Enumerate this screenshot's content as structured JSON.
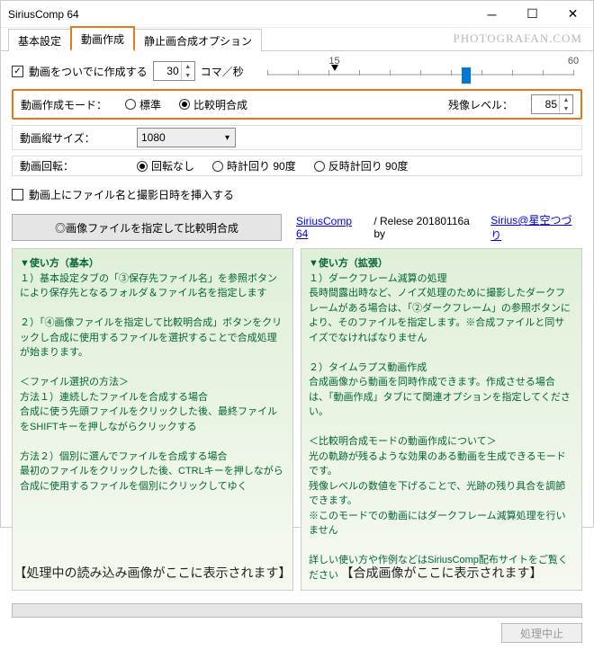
{
  "window": {
    "title": "SiriusComp 64"
  },
  "watermark": "PHOTOGRAFAN.COM",
  "tabs": [
    "基本設定",
    "動画作成",
    "静止画合成オプション"
  ],
  "active_tab": 1,
  "make_video": {
    "checked": true,
    "label": "動画をついでに作成する",
    "fps": "30",
    "fps_unit": "コマ／秒"
  },
  "slider": {
    "ticks": [
      "15",
      "60"
    ],
    "marker_pct": 22,
    "thumb_pct": 65
  },
  "mode_row": {
    "label": "動画作成モード：",
    "opt_std": "標準",
    "opt_comp": "比較明合成",
    "selected": "comp",
    "afterimg_label": "残像レベル：",
    "afterimg_val": "85"
  },
  "size_row": {
    "label": "動画縦サイズ：",
    "value": "1080"
  },
  "rot_row": {
    "label": "動画回転：",
    "opt_none": "回転なし",
    "opt_cw": "時計回り 90度",
    "opt_ccw": "反時計回り 90度",
    "selected": "none"
  },
  "insert_row": {
    "checked": false,
    "label": "動画上にファイル名と撮影日時を挿入する"
  },
  "big_button": "◎画像ファイルを指定して比較明合成",
  "info": {
    "link1": "SiriusComp 64",
    "release": " / Relese 20180116a  by   ",
    "link2": "Sirius@星空つづり"
  },
  "left_panel": {
    "h1": "▼使い方（基本）",
    "p1": "１）基本設定タブの「③保存先ファイル名」を参照ボタンにより保存先となるフォルダ＆ファイル名を指定します",
    "p2": "２）「④画像ファイルを指定して比較明合成」ボタンをクリックし合成に使用するファイルを選択することで合成処理が始まります。",
    "h2": "＜ファイル選択の方法＞",
    "p3": "方法１）連続したファイルを合成する場合\n合成に使う先頭ファイルをクリックした後、最終ファイルをSHIFTキーを押しながらクリックする",
    "p4": "方法２）個別に選んでファイルを合成する場合\n最初のファイルをクリックした後、CTRLキーを押しながら合成に使用するファイルを個別にクリックしてゆく",
    "big": "【処理中の読み込み画像がここに表示されます】"
  },
  "right_panel": {
    "h1": "▼使い方（拡張）",
    "p1": "１）ダークフレーム減算の処理\n長時間露出時など、ノイズ処理のために撮影したダークフレームがある場合は、「②ダークフレーム」の参照ボタンにより、そのファイルを指定します。※合成ファイルと同サイズでなければなりません",
    "p2": "２）タイムラプス動画作成\n合成画像から動画を同時作成できます。作成させる場合は、「動画作成」タブにて関連オプションを指定してください。",
    "p3": "＜比較明合成モードの動画作成について＞\n光の軌跡が残るような効果のある動画を生成できるモードです。\n残像レベルの数値を下げることで、光跡の残り具合を調節できます。\n※このモードでの動画にはダークフレーム減算処理を行いません",
    "p4": "詳しい使い方や作例などはSiriusComp配布サイトをご覧ください",
    "big": "【合成画像がここに表示されます】"
  },
  "cancel_btn": "処理中止"
}
